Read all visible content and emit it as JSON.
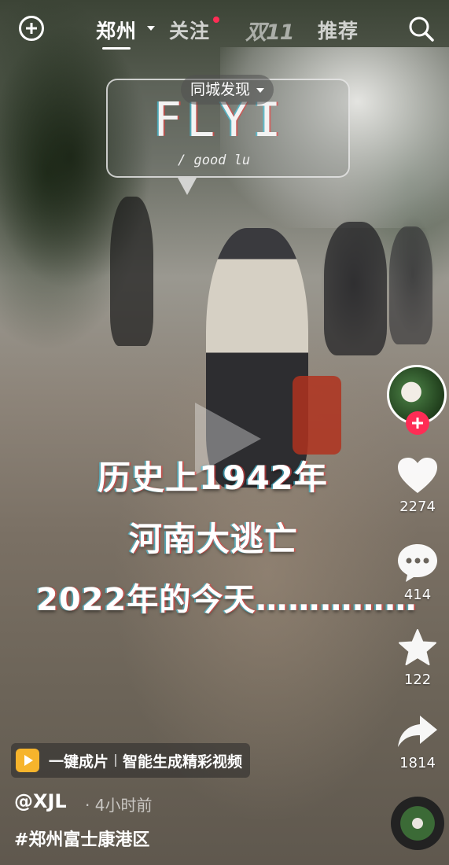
{
  "header": {
    "tabs": [
      "郑州",
      "关注",
      "双11",
      "推荐"
    ],
    "active_tab": "郑州"
  },
  "video": {
    "sticker_title": "FLYI",
    "sticker_subtitle": "/ good lu",
    "location_pill": "同城发现",
    "captions": [
      "历史上1942年",
      "河南大逃亡",
      "2022年的今天……………"
    ]
  },
  "sidebar": {
    "likes": "2274",
    "comments": "414",
    "favorites": "122",
    "shares": "1814"
  },
  "footer": {
    "promo_title": "一键成片",
    "promo_subtitle": "智能生成精彩视频",
    "author": "@XJL",
    "time": "· 4小时前",
    "hashtag": "#郑州富士康港区"
  },
  "icons": {
    "create": "plus-circle-icon",
    "search": "search-icon",
    "like": "heart-icon",
    "comment": "comment-icon",
    "favorite": "star-icon",
    "share": "share-icon",
    "music": "music-disc-icon"
  },
  "colors": {
    "accent": "#fe2c55",
    "promo": "#f6b42c"
  }
}
